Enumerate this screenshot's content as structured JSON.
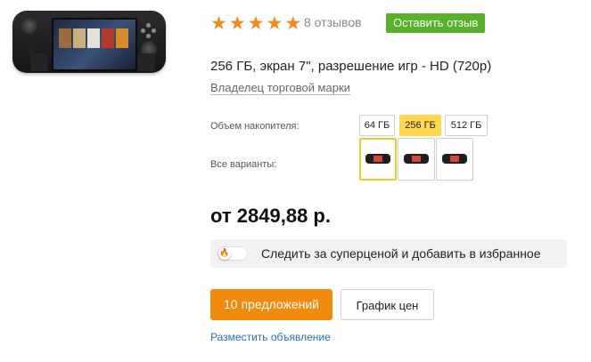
{
  "rating": {
    "stars": 5,
    "reviews_count_text": "8 отзывов",
    "leave_review_label": "Оставить отзыв"
  },
  "product": {
    "title": "256 ГБ, экран 7\", разрешение игр - HD (720p)",
    "brand_link": "Владелец торговой марки"
  },
  "storage": {
    "label": "Объем накопителя:",
    "options": [
      "64 ГБ",
      "256 ГБ",
      "512 ГБ"
    ],
    "selected": "256 ГБ"
  },
  "variants": {
    "label": "Все варианты:",
    "count": 3
  },
  "price": {
    "text": "от 2849,88 р."
  },
  "watch": {
    "text": "Следить за суперценой и добавить в избранное",
    "toggle_on": false,
    "icon": "flame-icon"
  },
  "actions": {
    "offers_label": "10 предложений",
    "price_chart_label": "График цен",
    "post_ad_label": "Разместить объявление"
  },
  "colors": {
    "star": "#f28b1a",
    "review_button": "#57b22a",
    "selected_option": "#ffd84e",
    "primary_button": "#f28a0e",
    "link": "#2b6dc2"
  }
}
